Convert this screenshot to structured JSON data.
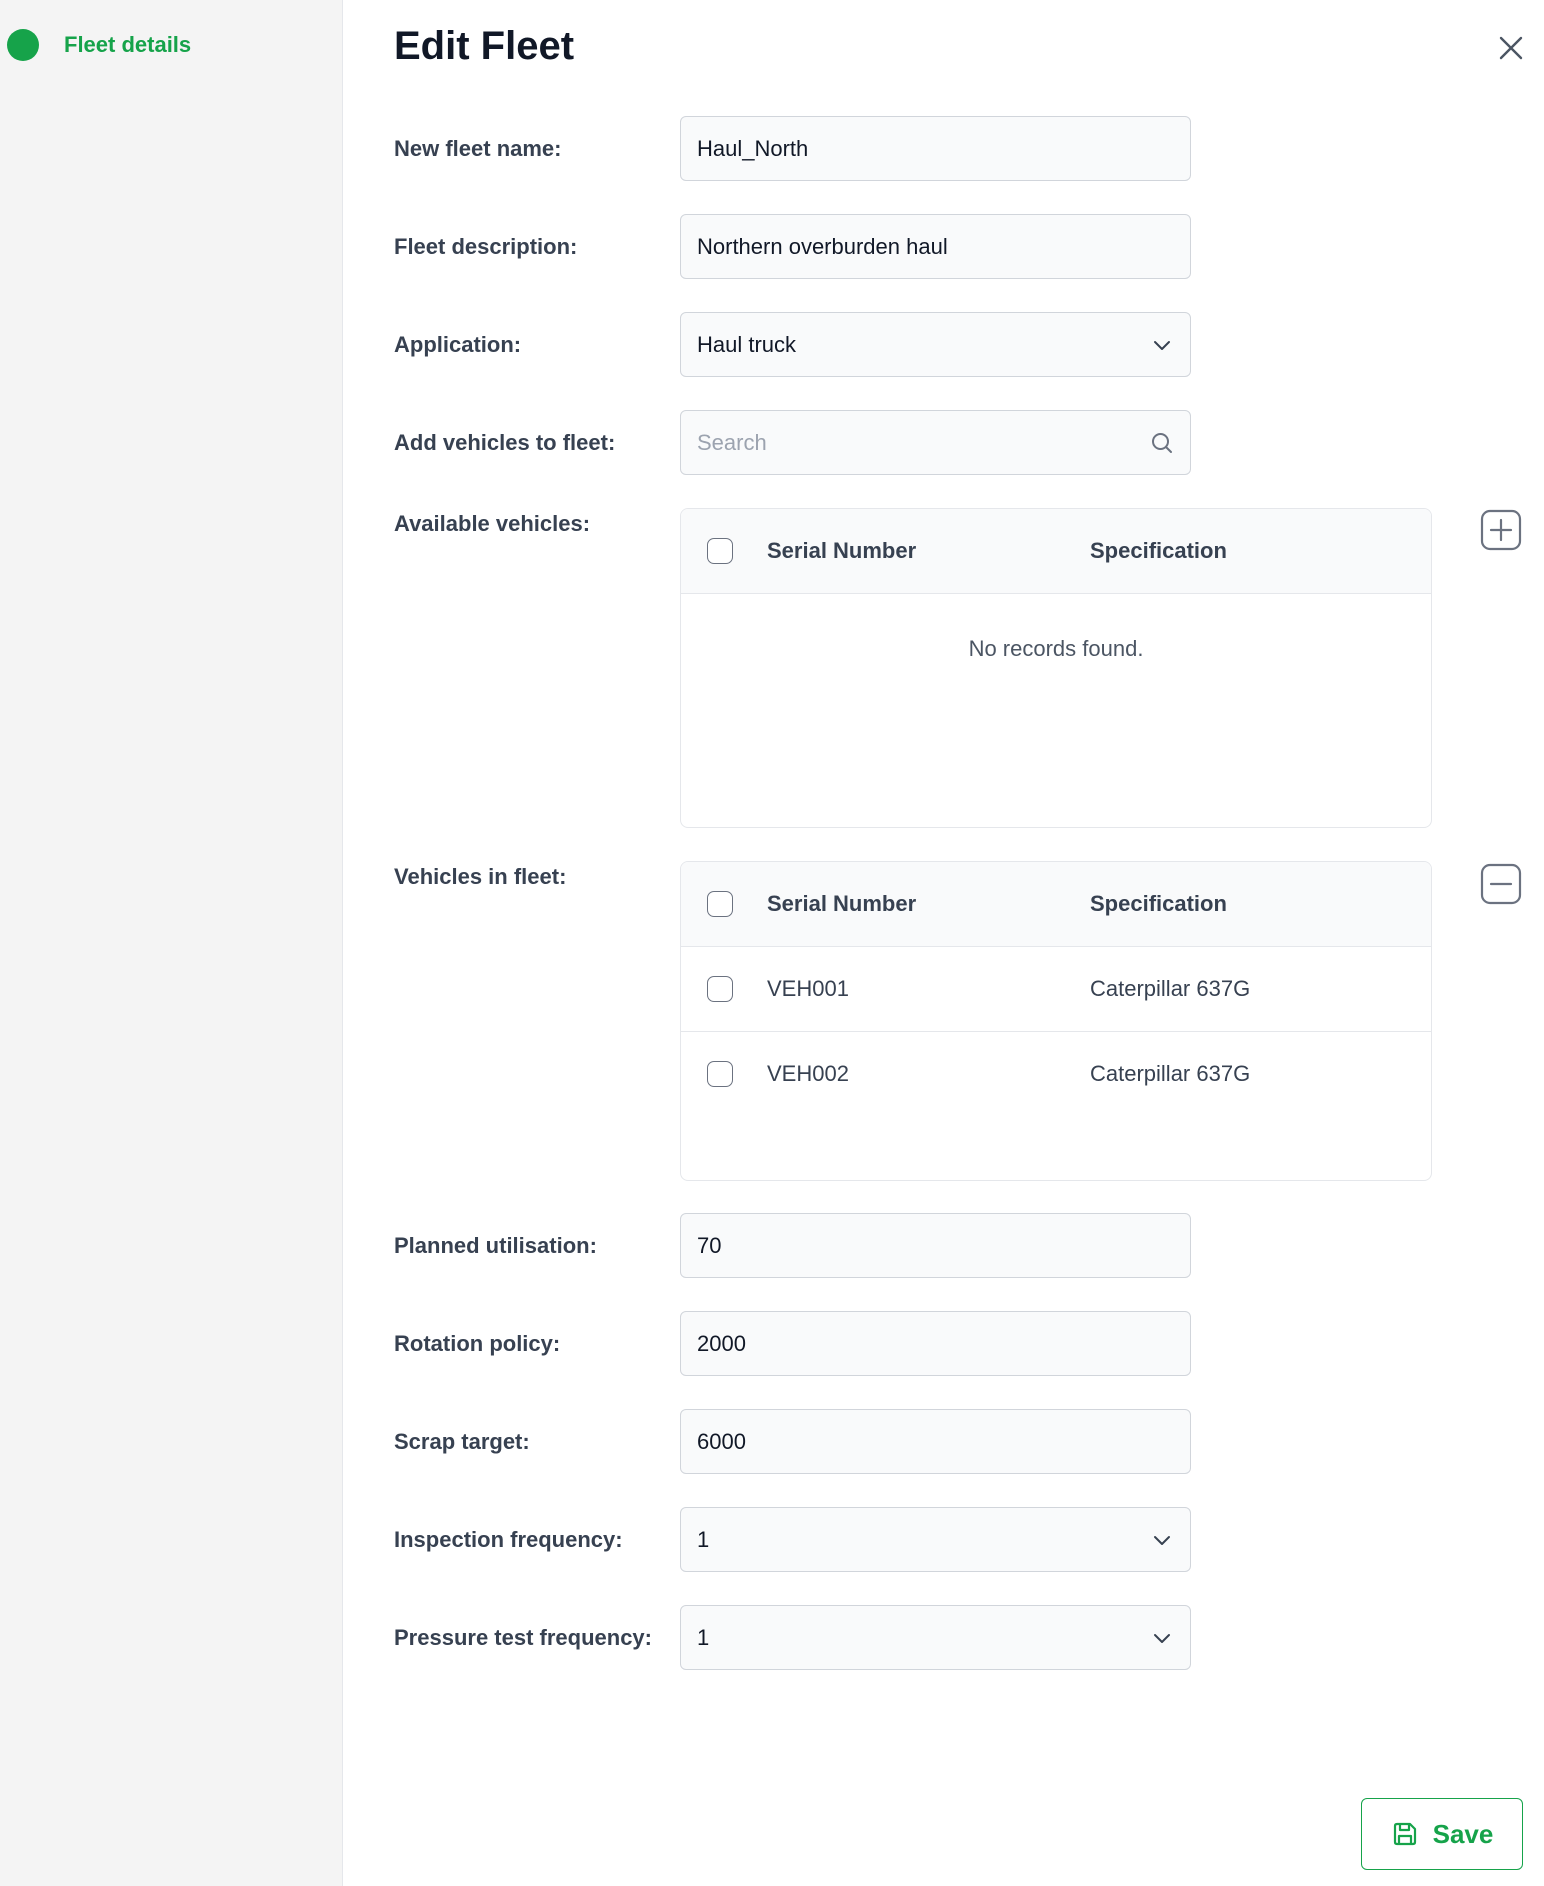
{
  "sidebar": {
    "steps": [
      {
        "label": "Fleet details",
        "status": "active",
        "color": "#16a34a"
      }
    ]
  },
  "header": {
    "title": "Edit Fleet",
    "close_icon": "close-icon"
  },
  "form": {
    "fleet_name": {
      "label": "New fleet name:",
      "value": "Haul_North"
    },
    "fleet_description": {
      "label": "Fleet description:",
      "value": "Northern overburden haul"
    },
    "application": {
      "label": "Application:",
      "value": "Haul truck",
      "icon": "chevron-down-icon"
    },
    "add_vehicles": {
      "label": "Add vehicles to fleet:",
      "placeholder": "Search",
      "icon": "search-icon"
    },
    "available_vehicles": {
      "label": "Available vehicles:",
      "columns": [
        "Serial Number",
        "Specification"
      ],
      "rows": [],
      "empty_message": "No records found.",
      "action_icon": "plus-square-icon"
    },
    "vehicles_in_fleet": {
      "label": "Vehicles in fleet:",
      "columns": [
        "Serial Number",
        "Specification"
      ],
      "rows": [
        {
          "serial": "VEH001",
          "spec": "Caterpillar 637G",
          "checked": false
        },
        {
          "serial": "VEH002",
          "spec": "Caterpillar 637G",
          "checked": false
        }
      ],
      "action_icon": "minus-square-icon"
    },
    "planned_utilisation": {
      "label": "Planned utilisation:",
      "value": "70"
    },
    "rotation_policy": {
      "label": "Rotation policy:",
      "value": "2000"
    },
    "scrap_target": {
      "label": "Scrap target:",
      "value": "6000"
    },
    "inspection_frequency": {
      "label": "Inspection frequency:",
      "value": "1",
      "icon": "chevron-down-icon"
    },
    "pressure_test_frequency": {
      "label": "Pressure test frequency:",
      "value": "1",
      "icon": "chevron-down-icon"
    }
  },
  "footer": {
    "save_label": "Save",
    "save_icon": "floppy-disk-icon",
    "accent_color": "#16a34a"
  }
}
